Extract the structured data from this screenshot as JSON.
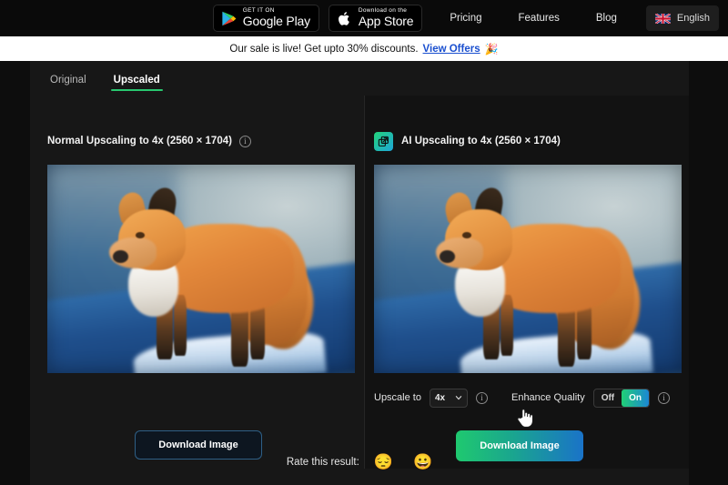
{
  "topbar": {
    "google_play": {
      "small": "GET IT ON",
      "big": "Google Play"
    },
    "app_store": {
      "small": "Download on the",
      "big": "App Store"
    },
    "links": [
      {
        "label": "Pricing"
      },
      {
        "label": "Features"
      },
      {
        "label": "Blog"
      }
    ],
    "language": "English"
  },
  "banner": {
    "text": "Our sale is live! Get upto 30% discounts.",
    "link": "View Offers",
    "emoji": "🎉"
  },
  "tabs": [
    {
      "label": "Original",
      "active": false
    },
    {
      "label": "Upscaled",
      "active": true
    }
  ],
  "left_pane": {
    "title": "Normal Upscaling to 4x (2560 × 1704)",
    "info_glyph": "i",
    "download_label": "Download Image"
  },
  "right_pane": {
    "title": "AI Upscaling to 4x (2560 × 1704)",
    "info_glyph": "i",
    "download_label": "Download Image",
    "controls": {
      "upscale_label": "Upscale to",
      "upscale_value": "4x",
      "upscale_info_glyph": "i",
      "enhance_label": "Enhance Quality",
      "toggle_off": "Off",
      "toggle_on": "On",
      "toggle_selected": "On",
      "enhance_info_glyph": "i"
    }
  },
  "rating": {
    "label": "Rate this result:",
    "negative_emoji": "😔",
    "positive_emoji": "😀"
  },
  "colors": {
    "accent_green": "#28c76f",
    "accent_blue": "#1a73c8",
    "banner_link": "#1a4fcf",
    "page_bg": "#171717"
  }
}
